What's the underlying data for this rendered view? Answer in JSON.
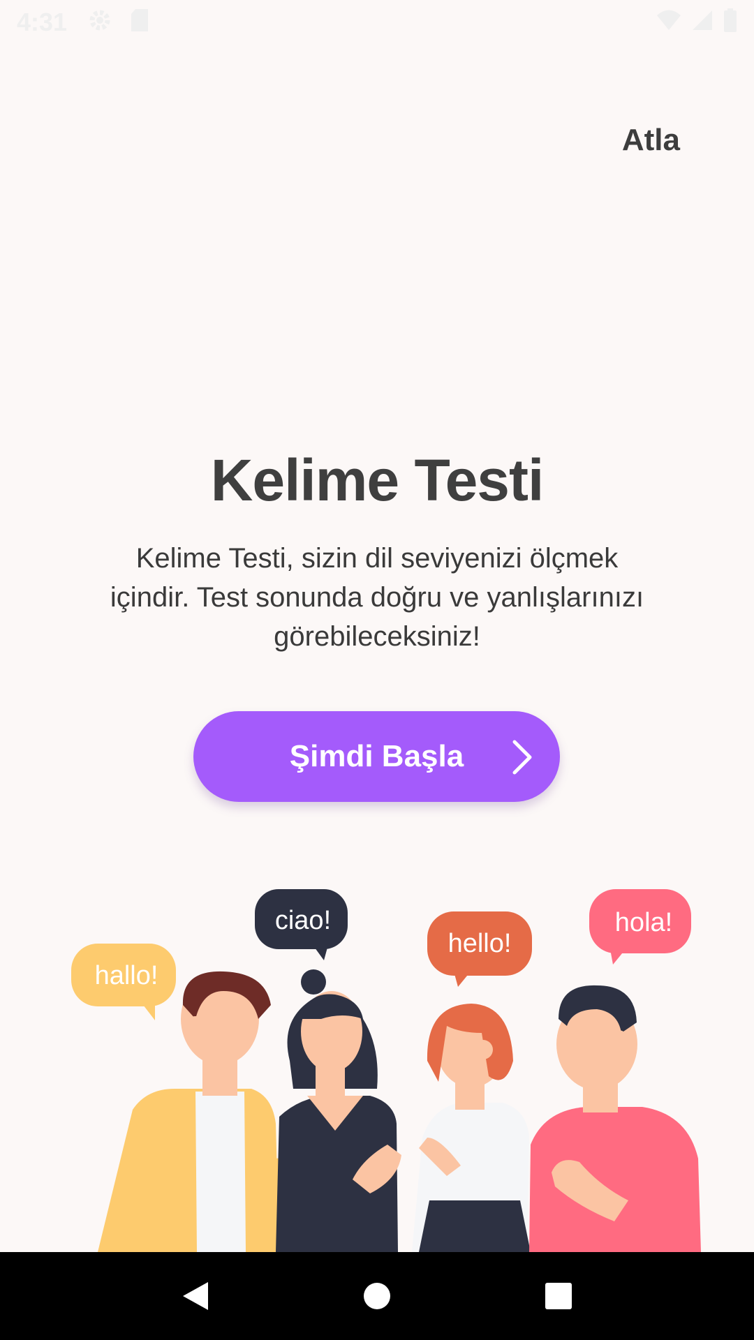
{
  "status_bar": {
    "time": "4:31"
  },
  "header": {
    "skip_label": "Atla"
  },
  "main": {
    "title": "Kelime Testi",
    "description": "Kelime Testi, sizin dil seviyenizi ölçmek içindir. Test sonunda doğru ve yanlışlarınızı görebileceksiniz!",
    "start_button_label": "Şimdi Başla"
  },
  "illustration": {
    "bubbles": [
      {
        "text": "hallo!",
        "color": "#FDCB6E"
      },
      {
        "text": "ciao!",
        "color": "#2D3142"
      },
      {
        "text": "hello!",
        "color": "#E56B47"
      },
      {
        "text": "hola!",
        "color": "#FF6B81"
      }
    ]
  },
  "colors": {
    "accent": "#A45BFB",
    "background": "#FCF8F7"
  },
  "icons": [
    "settings-icon",
    "sd-card-icon",
    "wifi-icon",
    "signal-icon",
    "battery-icon",
    "chevron-right-icon",
    "back-icon",
    "home-icon",
    "recents-icon"
  ]
}
